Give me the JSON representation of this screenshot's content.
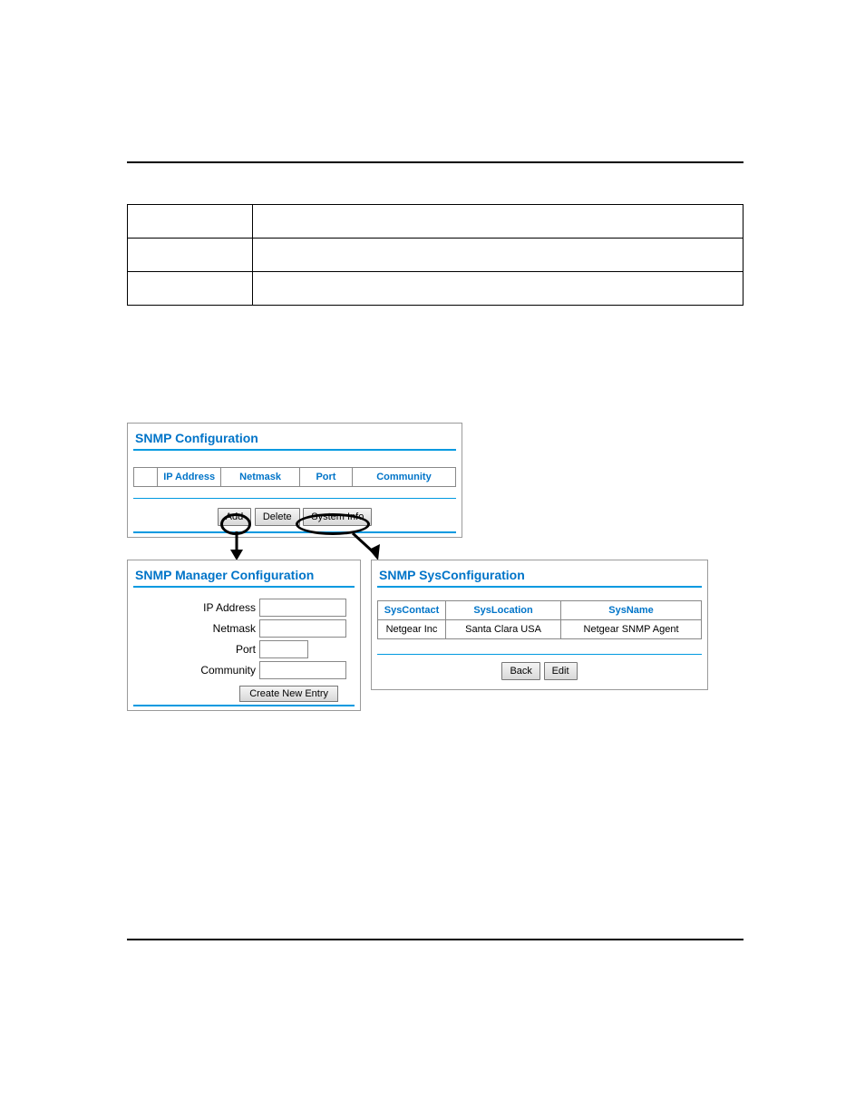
{
  "definition_rows": [
    {
      "term": "",
      "desc": ""
    },
    {
      "term": "",
      "desc": ""
    },
    {
      "term": "",
      "desc": ""
    }
  ],
  "snmp_config": {
    "title": "SNMP Configuration",
    "table": {
      "headers": [
        "IP Address",
        "Netmask",
        "Port",
        "Community"
      ]
    },
    "buttons": {
      "add": "Add",
      "delete": "Delete",
      "system_info": "System Info"
    }
  },
  "snmp_manager": {
    "title": "SNMP Manager Configuration",
    "fields": {
      "ip_address_label": "IP Address",
      "netmask_label": "Netmask",
      "port_label": "Port",
      "community_label": "Community",
      "ip_address_value": "",
      "netmask_value": "",
      "port_value": "",
      "community_value": ""
    },
    "create_button": "Create New Entry"
  },
  "snmp_sys": {
    "title": "SNMP SysConfiguration",
    "headers": [
      "SysContact",
      "SysLocation",
      "SysName"
    ],
    "row": {
      "contact": "Netgear Inc",
      "location": "Santa Clara USA",
      "name": "Netgear SNMP Agent"
    },
    "buttons": {
      "back": "Back",
      "edit": "Edit"
    }
  }
}
